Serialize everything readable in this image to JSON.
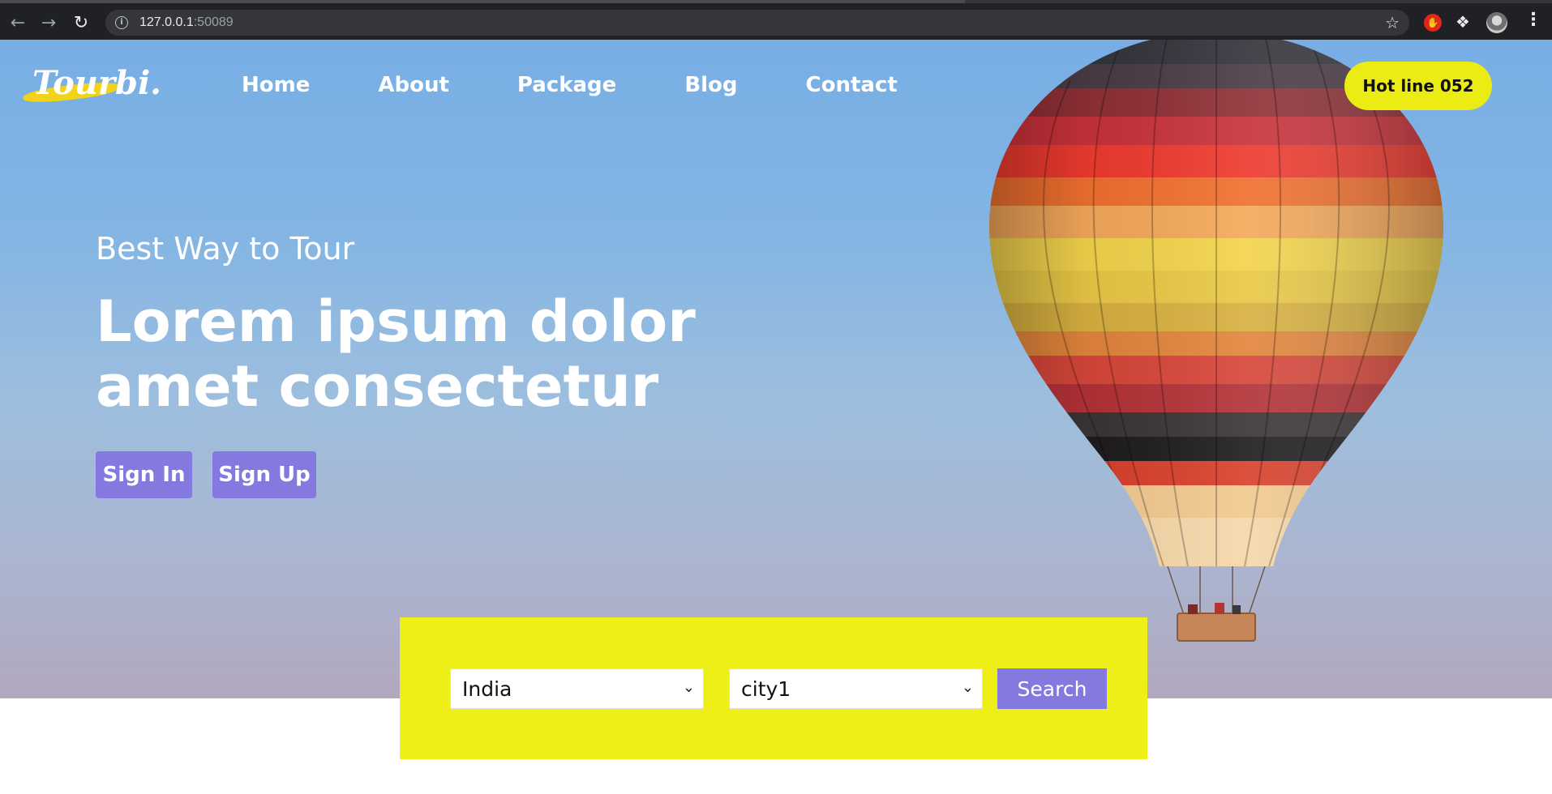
{
  "browser": {
    "url_host": "127.0.0.1",
    "url_port": ":50089",
    "icons": [
      "back-icon",
      "forward-icon",
      "reload-icon",
      "info-icon",
      "star-icon",
      "adblock-icon",
      "extensions-icon",
      "profile-icon",
      "menu-icon"
    ]
  },
  "site": {
    "logo_text": "Tourbi.",
    "nav": [
      "Home",
      "About",
      "Package",
      "Blog",
      "Contact"
    ],
    "hotline_label": "Hot line 052"
  },
  "hero": {
    "subtitle": "Best Way to Tour",
    "title": "Lorem ipsum dolor amet consectetur",
    "signin_label": "Sign In",
    "signup_label": "Sign Up"
  },
  "search": {
    "country_value": "India",
    "city_value": "city1",
    "button_label": "Search"
  },
  "colors": {
    "accent_purple": "#8379de",
    "accent_yellow": "#eeef16"
  }
}
